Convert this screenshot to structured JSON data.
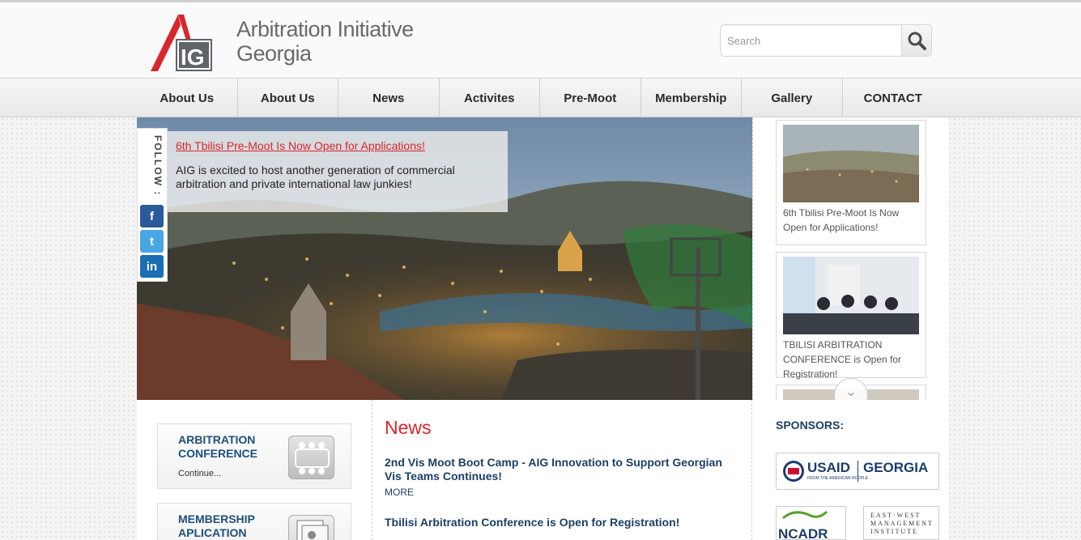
{
  "header": {
    "logo_text": "AIG",
    "title_line1": "Arbitration Initiative",
    "title_line2": "Georgia"
  },
  "search": {
    "placeholder": "Search"
  },
  "nav": {
    "items": [
      "About Us",
      "About Us",
      "News",
      "Activites",
      "Pre-Moot",
      "Membership",
      "Gallery",
      "CONTACT"
    ]
  },
  "slider": {
    "caption_link": "6th Tbilisi Pre-Moot Is Now Open for Applications!",
    "caption_text": "AIG is excited to host another generation of commercial arbitration and private international law junkies!"
  },
  "follow": {
    "label": "FOLLOW :",
    "facebook": "f",
    "twitter": "t",
    "linkedin": "in"
  },
  "thumbs": [
    {
      "title": "6th Tbilisi Pre-Moot Is Now Open for Applications!"
    },
    {
      "title": "TBILISI ARBITRATION CONFERENCE is Open for Registration!"
    }
  ],
  "promos": [
    {
      "title": "ARBITRATION CONFERENCE",
      "sub": "Continue..."
    },
    {
      "title": "MEMBERSHIP APLICATION",
      "sub": ""
    }
  ],
  "news": {
    "heading": "News",
    "items": [
      {
        "title": "2nd Vis Moot Boot Camp - AIG Innovation to Support Georgian Vis Teams Continues!",
        "more": "MORE"
      },
      {
        "title": "Tbilisi Arbitration Conference is Open for Registration!"
      }
    ]
  },
  "sponsors": {
    "heading": "SPONSORS:",
    "usaid_name": "USAID",
    "usaid_country": "GEORGIA",
    "usaid_tagline": "FROM THE AMERICAN PEOPLE",
    "ncadr": "NCADR",
    "ewmi_line1": "EAST·WEST",
    "ewmi_line2": "MANAGEMENT",
    "ewmi_line3": "INSTITUTE"
  },
  "colors": {
    "accent_red": "#d8262c",
    "navy": "#1c3f66"
  }
}
